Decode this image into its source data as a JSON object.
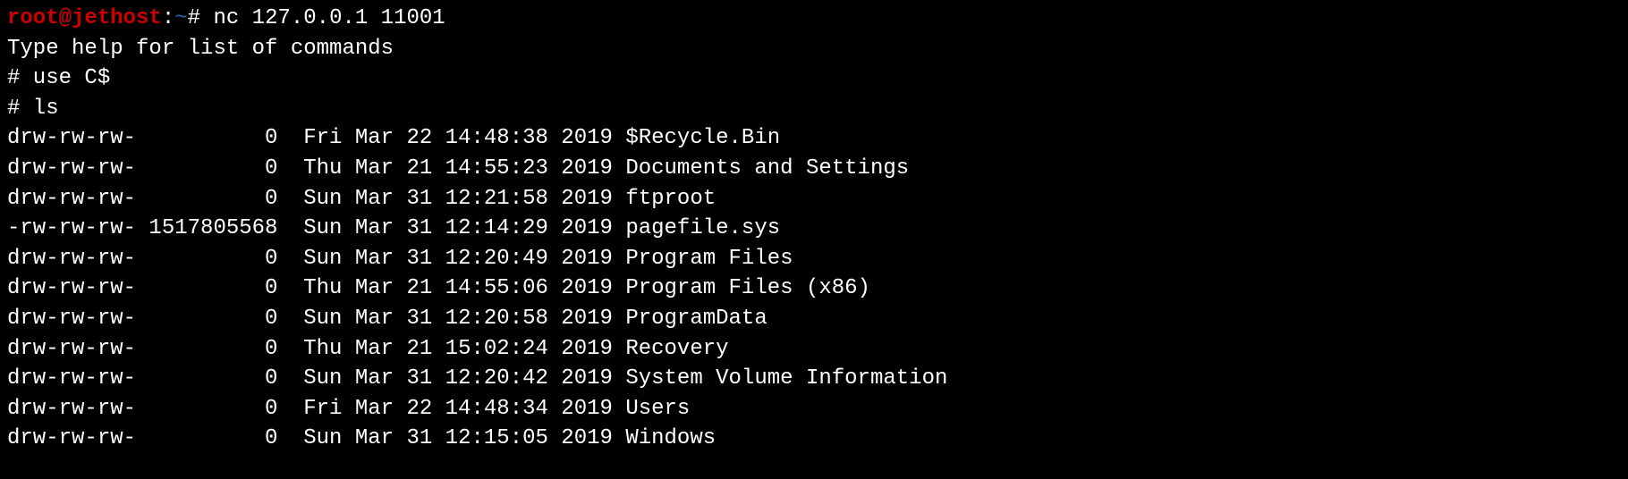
{
  "prompt": {
    "user": "root@jethost",
    "sep": ":",
    "path": "~",
    "symbol": "#"
  },
  "commands": {
    "nc": "nc 127.0.0.1 11001",
    "help_hint": "Type help for list of commands",
    "use": "# use C$",
    "ls": "# ls"
  },
  "listing": [
    {
      "perms": "drw-rw-rw-",
      "size": "          0",
      "date": "Fri Mar 22 14:48:38 2019",
      "name": "$Recycle.Bin"
    },
    {
      "perms": "drw-rw-rw-",
      "size": "          0",
      "date": "Thu Mar 21 14:55:23 2019",
      "name": "Documents and Settings"
    },
    {
      "perms": "drw-rw-rw-",
      "size": "          0",
      "date": "Sun Mar 31 12:21:58 2019",
      "name": "ftproot"
    },
    {
      "perms": "-rw-rw-rw-",
      "size": " 1517805568",
      "date": "Sun Mar 31 12:14:29 2019",
      "name": "pagefile.sys"
    },
    {
      "perms": "drw-rw-rw-",
      "size": "          0",
      "date": "Sun Mar 31 12:20:49 2019",
      "name": "Program Files"
    },
    {
      "perms": "drw-rw-rw-",
      "size": "          0",
      "date": "Thu Mar 21 14:55:06 2019",
      "name": "Program Files (x86)"
    },
    {
      "perms": "drw-rw-rw-",
      "size": "          0",
      "date": "Sun Mar 31 12:20:58 2019",
      "name": "ProgramData"
    },
    {
      "perms": "drw-rw-rw-",
      "size": "          0",
      "date": "Thu Mar 21 15:02:24 2019",
      "name": "Recovery"
    },
    {
      "perms": "drw-rw-rw-",
      "size": "          0",
      "date": "Sun Mar 31 12:20:42 2019",
      "name": "System Volume Information"
    },
    {
      "perms": "drw-rw-rw-",
      "size": "          0",
      "date": "Fri Mar 22 14:48:34 2019",
      "name": "Users"
    },
    {
      "perms": "drw-rw-rw-",
      "size": "          0",
      "date": "Sun Mar 31 12:15:05 2019",
      "name": "Windows"
    }
  ]
}
